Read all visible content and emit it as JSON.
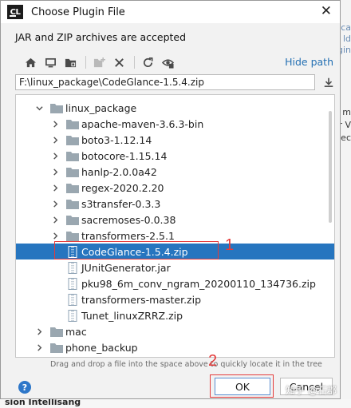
{
  "background": {
    "side_texts": [
      "ca",
      "ld",
      "gin",
      "m",
      "r V",
      "tec"
    ],
    "bottom_text": "sion Intellisang"
  },
  "dialog": {
    "app_icon_text": "CL",
    "title": "Choose Plugin File",
    "close_glyph": "✕",
    "hint": "JAR and ZIP archives are accepted",
    "hide_path_label": "Hide path",
    "path_value": "F:\\linux_package\\CodeGlance-1.5.4.zip",
    "toolbar_icons": [
      "home-icon",
      "desktop-icon",
      "project-icon",
      "new-folder-icon",
      "delete-icon",
      "refresh-icon",
      "show-hidden-icon"
    ],
    "tree": [
      {
        "label": "linux_package",
        "kind": "folder",
        "depth": 0,
        "expanded": true
      },
      {
        "label": "apache-maven-3.6.3-bin",
        "kind": "folder",
        "depth": 1
      },
      {
        "label": "boto3-1.12.14",
        "kind": "folder",
        "depth": 1
      },
      {
        "label": "botocore-1.15.14",
        "kind": "folder",
        "depth": 1
      },
      {
        "label": "hanlp-2.0.0a42",
        "kind": "folder",
        "depth": 1
      },
      {
        "label": "regex-2020.2.20",
        "kind": "folder",
        "depth": 1
      },
      {
        "label": "s3transfer-0.3.3",
        "kind": "folder",
        "depth": 1
      },
      {
        "label": "sacremoses-0.0.38",
        "kind": "folder",
        "depth": 1
      },
      {
        "label": "transformers-2.5.1",
        "kind": "folder",
        "depth": 1
      },
      {
        "label": "CodeGlance-1.5.4.zip",
        "kind": "zip",
        "depth": 1,
        "selected": true
      },
      {
        "label": "JUnitGenerator.jar",
        "kind": "zip",
        "depth": 1
      },
      {
        "label": "pku98_6m_conv_ngram_20200110_134736.zip",
        "kind": "zip",
        "depth": 1
      },
      {
        "label": "transformers-master.zip",
        "kind": "zip",
        "depth": 1
      },
      {
        "label": "Tunet_linuxZRRZ.zip",
        "kind": "zip",
        "depth": 1
      },
      {
        "label": "mac",
        "kind": "folder",
        "depth": 0
      },
      {
        "label": "phone_backup",
        "kind": "folder",
        "depth": 0
      }
    ],
    "drag_hint": "Drag and drop a file into the space above to quickly locate it in the tree",
    "help_label": "?",
    "ok_label": "OK",
    "cancel_label": "Cancel"
  },
  "annotations": {
    "marker_1": "1",
    "marker_2": "2",
    "color": "#e43b3b"
  },
  "watermark": "知乎 @石郡",
  "colors": {
    "selection": "#2675bf",
    "link": "#2470b3",
    "folder": "#9aa7b0",
    "zip": "#8fa3b5"
  }
}
